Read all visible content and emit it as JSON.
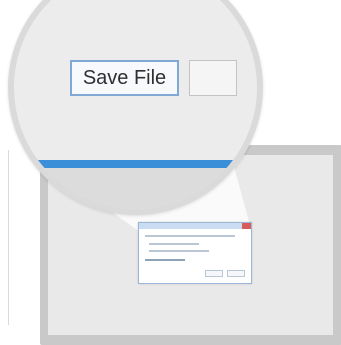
{
  "zoom_view": {
    "save_button_label": "Save File"
  },
  "colors": {
    "accent_blue": "#3b8fd8",
    "button_border": "#7fa8d4",
    "monitor_frame": "#c9c9c9",
    "close_red": "#d85b5b"
  },
  "icons": {
    "magnifier": "magnifier-circle",
    "dialog_close": "close-icon"
  }
}
